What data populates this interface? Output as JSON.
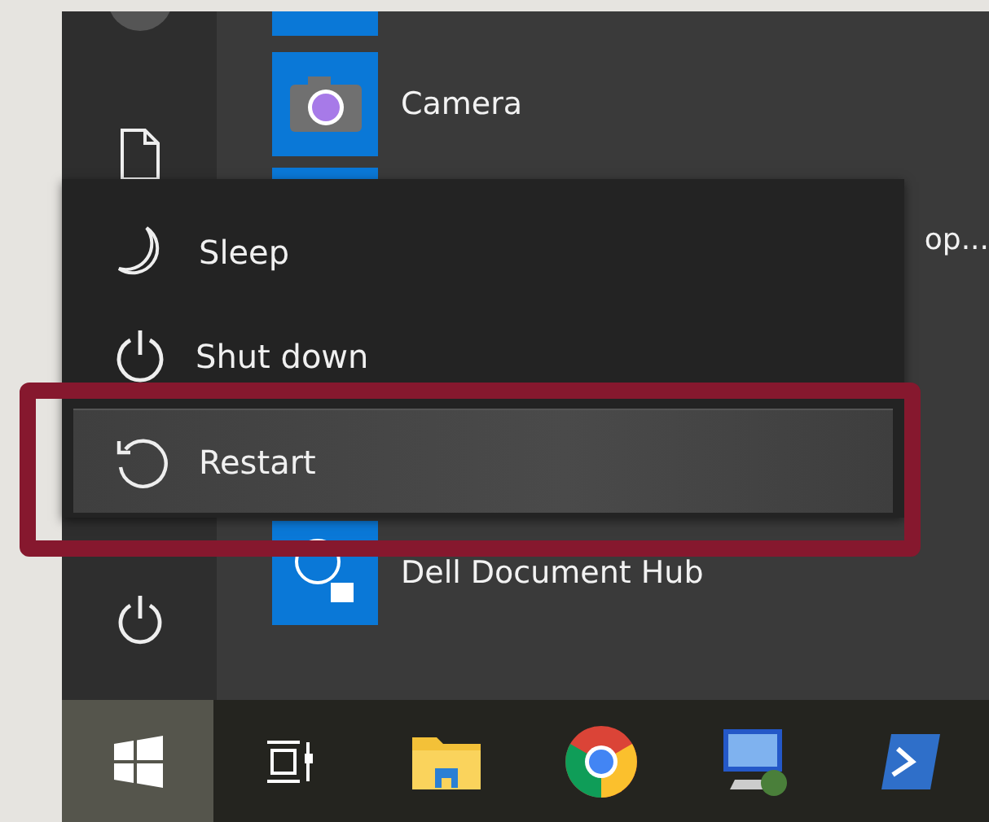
{
  "apps": [
    {
      "kind": "camera",
      "label": "Camera"
    },
    {
      "kind": "tile",
      "label": "op..."
    },
    {
      "kind": "dell",
      "label": "Dell Document Hub"
    }
  ],
  "power_menu": {
    "items": [
      {
        "kind": "sleep",
        "label": "Sleep",
        "selected": false
      },
      {
        "kind": "shutdown",
        "label": "Shut down",
        "selected": false
      },
      {
        "kind": "restart",
        "label": "Restart",
        "selected": true
      }
    ]
  },
  "taskbar": {
    "start_selected": true
  }
}
